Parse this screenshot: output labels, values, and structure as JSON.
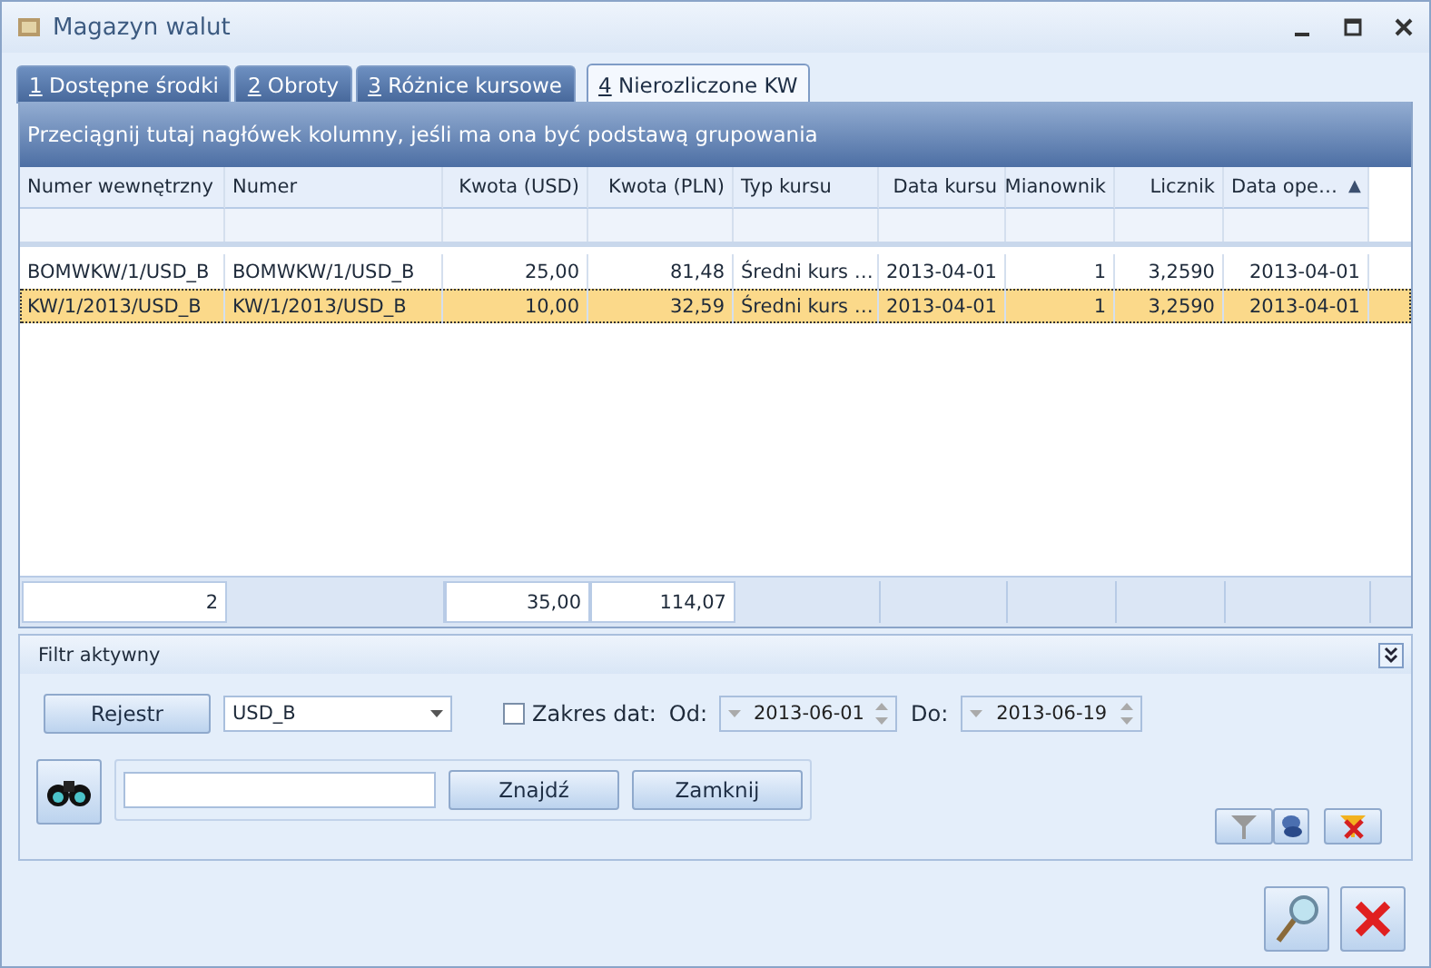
{
  "window": {
    "title": "Magazyn walut"
  },
  "tabs": [
    {
      "key": "1",
      "label": "Dostępne środki",
      "selected": false
    },
    {
      "key": "2",
      "label": "Obroty",
      "selected": false
    },
    {
      "key": "3",
      "label": "Różnice kursowe",
      "selected": false
    },
    {
      "key": "4",
      "label": "Nierozliczone KW",
      "selected": true
    }
  ],
  "table": {
    "group_hint": "Przeciągnij tutaj nagłówek kolumny, jeśli ma ona być podstawą grupowania",
    "columns": [
      {
        "label": "Numer wewnętrzny",
        "kind": "text",
        "total": "2"
      },
      {
        "label": "Numer",
        "kind": "text"
      },
      {
        "label": "Kwota (USD)",
        "kind": "number",
        "total": "35,00"
      },
      {
        "label": "Kwota (PLN)",
        "kind": "number",
        "total": "114,07"
      },
      {
        "label": "Typ kursu",
        "kind": "text"
      },
      {
        "label": "Data kursu",
        "kind": "number"
      },
      {
        "label": "Mianownik",
        "kind": "number"
      },
      {
        "label": "Licznik",
        "kind": "number"
      },
      {
        "label": "Data ope…",
        "kind": "date",
        "sort_mark": "▲"
      }
    ],
    "rows": [
      {
        "selected": false,
        "cells": [
          "BOMWKW/1/USD_B",
          "BOMWKW/1/USD_B",
          "25,00",
          "81,48",
          "Średni kurs …",
          "2013-04-01",
          "1",
          "3,2590",
          "2013-04-01"
        ]
      },
      {
        "selected": true,
        "cells": [
          "KW/1/2013/USD_B",
          "KW/1/2013/USD_B",
          "10,00",
          "32,59",
          "Średni kurs …",
          "2013-04-01",
          "1",
          "3,2590",
          "2013-04-01"
        ]
      }
    ]
  },
  "filter": {
    "title": "Filtr aktywny",
    "register_button": "Rejestr",
    "register_value": "USD_B",
    "date_range": {
      "label": "Zakres dat:",
      "checked": false,
      "from_label": "Od:",
      "from": "2013-06-01",
      "to_label": "Do:",
      "to": "2013-06-19"
    },
    "search": {
      "find_button": "Znajdź",
      "close_button": "Zamknij"
    }
  }
}
